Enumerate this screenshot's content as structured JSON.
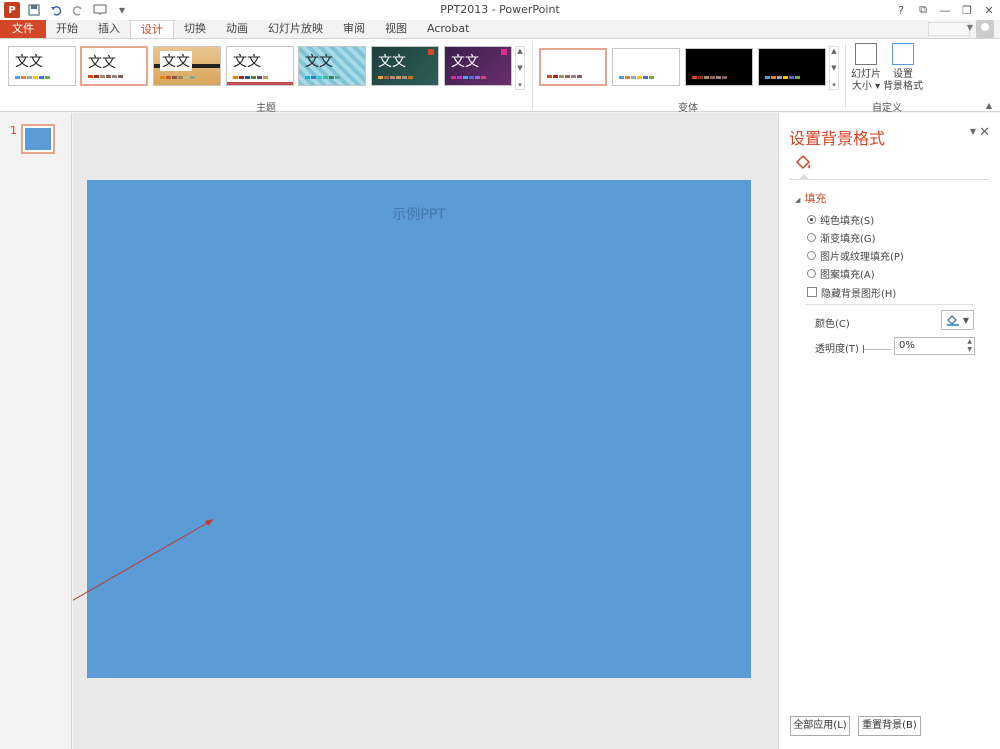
{
  "window": {
    "title": "PPT2013 - PowerPoint"
  },
  "qat": {
    "app_logo": "P",
    "save_icon": "save-icon",
    "undo_icon": "undo-icon",
    "redo_icon": "redo-icon",
    "present_icon": "present-from-beginning-icon",
    "customize_icon": "customize-qat-icon"
  },
  "window_controls": {
    "help": "?",
    "ribbon_display": "⧉",
    "minimize": "—",
    "restore": "❐",
    "close": "✕"
  },
  "tabs": [
    {
      "label": "文件"
    },
    {
      "label": "开始"
    },
    {
      "label": "插入"
    },
    {
      "label": "设计"
    },
    {
      "label": "切换"
    },
    {
      "label": "动画"
    },
    {
      "label": "幻灯片放映"
    },
    {
      "label": "审阅"
    },
    {
      "label": "视图"
    },
    {
      "label": "Acrobat"
    }
  ],
  "ribbon": {
    "themes_group_label": "主题",
    "variants_group_label": "变体",
    "customize_group_label": "自定义",
    "theme_text": "文文",
    "slide_size_label": "幻灯片\n大小",
    "slide_size_line1": "幻灯片",
    "slide_size_line2": "大小 ▾",
    "format_bg_line1": "设置",
    "format_bg_line2": "背景格式"
  },
  "thumbnail": {
    "number": "1"
  },
  "slide": {
    "title": "示例PPT",
    "background": "#5b9bd5"
  },
  "format_pane": {
    "title": "设置背景格式",
    "section": "填充",
    "fill_options": [
      {
        "label": "纯色填充(S)",
        "selected": true
      },
      {
        "label": "渐变填充(G)",
        "selected": false
      },
      {
        "label": "图片或纹理填充(P)",
        "selected": false
      },
      {
        "label": "图案填充(A)",
        "selected": false
      }
    ],
    "hide_bg_graphics": "隐藏背景图形(H)",
    "color_label": "颜色(C)",
    "transparency_label": "透明度(T)",
    "transparency_value": "0%",
    "apply_all": "全部应用(L)",
    "reset_bg": "重置背景(B)"
  },
  "colors": {
    "accent": "#d24726",
    "slide_blue": "#5b9bd5"
  }
}
